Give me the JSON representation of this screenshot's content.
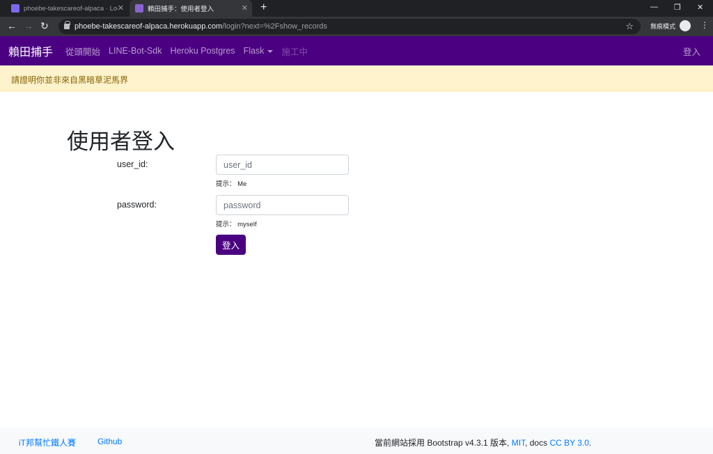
{
  "browser": {
    "tabs": [
      {
        "title": "phoebe-takescareof-alpaca · Log"
      },
      {
        "title": "賴田捕手：使用者登入"
      }
    ],
    "new_tab": "+",
    "close": "✕",
    "url_host": "phoebe-takescareof-alpaca.herokuapp.com",
    "url_path": "/login?next=%2Fshow_records",
    "incognito_label": "無痕模式"
  },
  "navbar": {
    "brand": "賴田捕手",
    "links": [
      "從頭開始",
      "LINE-Bot-Sdk",
      "Heroku Postgres",
      "Flask",
      "施工中"
    ],
    "login": "登入"
  },
  "alert": {
    "text": "請證明你並非來自黑暗草泥馬界"
  },
  "form": {
    "title": "使用者登入",
    "user_id": {
      "label": "user_id:",
      "placeholder": "user_id",
      "hint": "提示： Me"
    },
    "password": {
      "label": "password:",
      "placeholder": "password",
      "hint": "提示： myself"
    },
    "submit": "登入"
  },
  "footer": {
    "link1": "iT邦幫忙鐵人賽",
    "link2": "Github",
    "credit_prefix": "當前網站採用 Bootstrap v4.3.1 版本,",
    "mit": "MIT",
    "credit_mid": ", docs",
    "cc": "CC BY 3.0",
    "credit_end": "."
  },
  "colors": {
    "navbar": "#4b0082",
    "alert_bg": "#fff3cd",
    "alert_text": "#856404",
    "link": "#007bff"
  }
}
